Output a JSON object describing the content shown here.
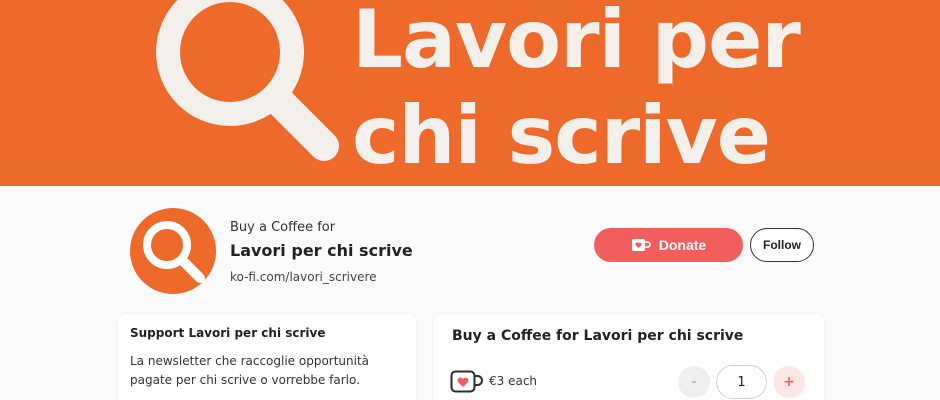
{
  "banner": {
    "line1": "Lavori per",
    "line2": "chi scrive"
  },
  "profile": {
    "pre_title": "Buy a Coffee for",
    "title": "Lavori per chi scrive",
    "url": "ko-fi.com/lavori_scrivere",
    "donate_label": "Donate",
    "follow_label": "Follow"
  },
  "support_card": {
    "title": "Support Lavori per chi scrive",
    "description": "La newsletter che raccoglie opportunità pagate per chi scrive o vorrebbe farlo."
  },
  "coffee_card": {
    "title": "Buy a Coffee for Lavori per chi scrive",
    "price": "€3 each",
    "minus_label": "-",
    "quantity": "1",
    "plus_label": "+"
  },
  "icons": {
    "banner": "magnifier-icon",
    "avatar": "magnifier-icon",
    "donate": "coffee-cup-icon",
    "price": "coffee-cup-heart-icon"
  },
  "colors": {
    "brand_orange": "#ee6a2a",
    "donate_red": "#f25d5d"
  }
}
